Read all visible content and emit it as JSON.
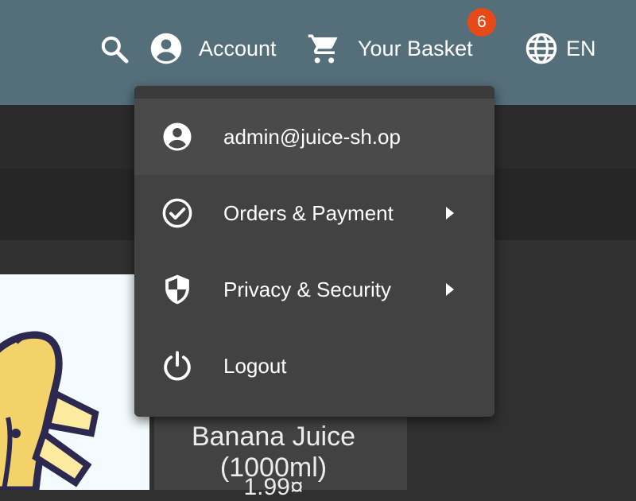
{
  "toolbar": {
    "search_icon": "search-icon",
    "account_label": "Account",
    "basket_label": "Your Basket",
    "basket_count": "6",
    "language_label": "EN"
  },
  "menu": {
    "items": [
      {
        "icon": "account-circle-icon",
        "label": "admin@juice-sh.op",
        "has_submenu": false
      },
      {
        "icon": "check-circle-icon",
        "label": "Orders & Payment",
        "has_submenu": true
      },
      {
        "icon": "shield-icon",
        "label": "Privacy & Security",
        "has_submenu": true
      },
      {
        "icon": "power-icon",
        "label": "Logout",
        "has_submenu": false
      }
    ]
  },
  "product": {
    "title": "Banana Juice (1000ml)",
    "price": "1.99¤"
  },
  "colors": {
    "toolbar": "#546e7a",
    "menu_bg": "#424242",
    "badge": "#e64a19",
    "page_bg": "#303030"
  }
}
